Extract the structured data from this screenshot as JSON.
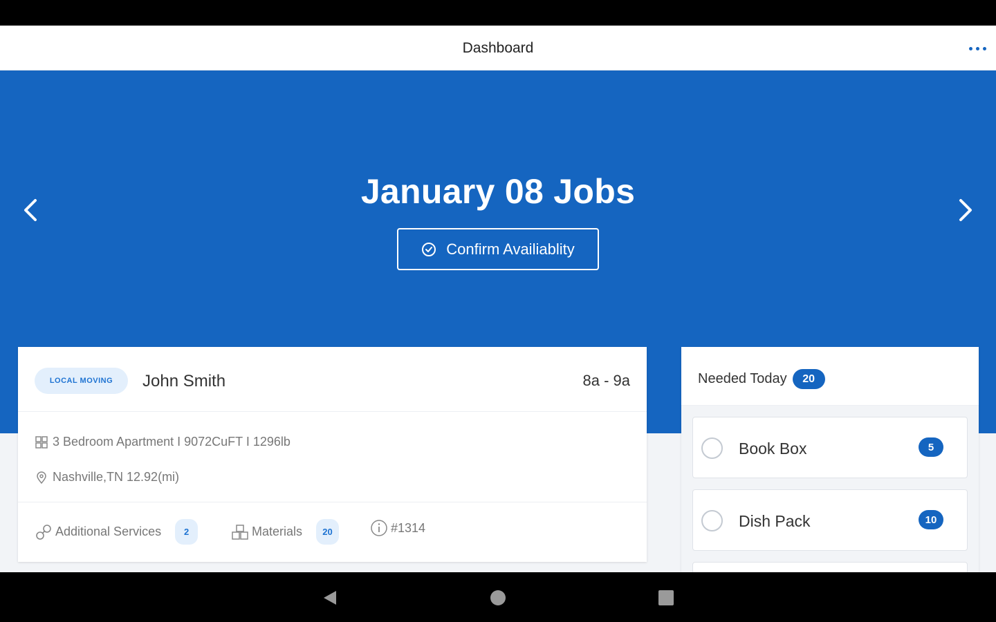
{
  "app_bar": {
    "title": "Dashboard",
    "more_icon": "more-horizontal-icon"
  },
  "hero": {
    "title": "January 08 Jobs",
    "prev_icon": "chevron-left-icon",
    "next_icon": "chevron-right-icon",
    "confirm_label": "Confirm Availiablity",
    "confirm_icon": "check-circle-icon"
  },
  "job": {
    "type": "LOCAL MOVING",
    "customer": "John Smith",
    "time": "8a - 9a",
    "details": "3 Bedroom Apartment I 9072CuFT I 1296lb",
    "location": "Nashville,TN 12.92(mi)",
    "additional_services_label": "Additional Services",
    "additional_services_count": "2",
    "materials_label": "Materials",
    "materials_count": "20",
    "job_number": "#1314"
  },
  "needed_today": {
    "title": "Needed Today",
    "count": "20",
    "items": [
      {
        "label": "Book Box",
        "qty": "5"
      },
      {
        "label": "Dish Pack",
        "qty": "10"
      }
    ]
  },
  "system_nav": {
    "back_icon": "back-triangle-icon",
    "home_icon": "home-circle-icon",
    "recents_icon": "recents-square-icon"
  },
  "colors": {
    "primary": "#1565c0",
    "pill_bg": "#e3effc",
    "pill_text": "#1e73d2"
  }
}
